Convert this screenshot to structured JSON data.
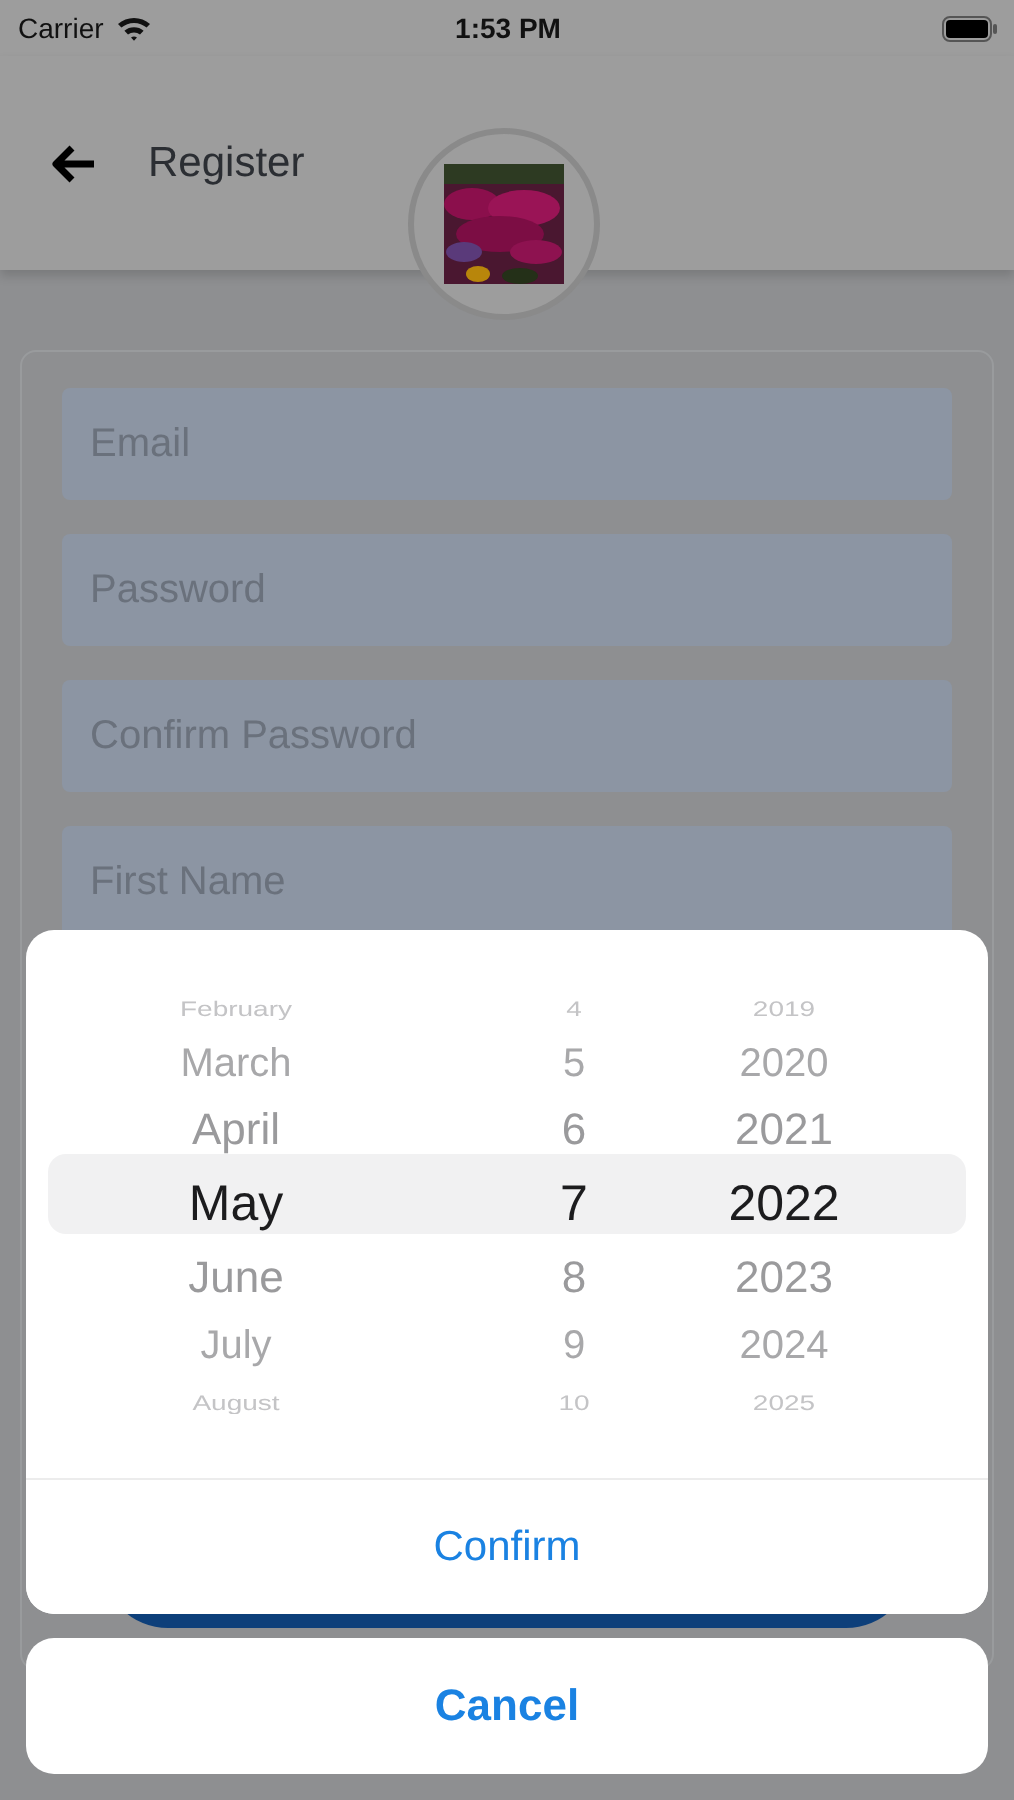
{
  "status_bar": {
    "carrier": "Carrier",
    "time": "1:53 PM"
  },
  "header": {
    "title": "Register"
  },
  "form": {
    "fields": [
      {
        "placeholder": "Email"
      },
      {
        "placeholder": "Password"
      },
      {
        "placeholder": "Confirm Password"
      },
      {
        "placeholder": "First Name"
      }
    ]
  },
  "date_picker": {
    "columns": [
      {
        "kind": "month",
        "items": [
          {
            "label": "February",
            "selected": false
          },
          {
            "label": "March",
            "selected": false
          },
          {
            "label": "April",
            "selected": false
          },
          {
            "label": "May",
            "selected": true
          },
          {
            "label": "June",
            "selected": false
          },
          {
            "label": "July",
            "selected": false
          },
          {
            "label": "August",
            "selected": false
          }
        ]
      },
      {
        "kind": "day",
        "items": [
          {
            "label": "4",
            "selected": false
          },
          {
            "label": "5",
            "selected": false
          },
          {
            "label": "6",
            "selected": false
          },
          {
            "label": "7",
            "selected": true
          },
          {
            "label": "8",
            "selected": false
          },
          {
            "label": "9",
            "selected": false
          },
          {
            "label": "10",
            "selected": false
          }
        ]
      },
      {
        "kind": "year",
        "items": [
          {
            "label": "2019",
            "selected": false
          },
          {
            "label": "2020",
            "selected": false
          },
          {
            "label": "2021",
            "selected": false
          },
          {
            "label": "2022",
            "selected": true
          },
          {
            "label": "2023",
            "selected": false
          },
          {
            "label": "2024",
            "selected": false
          },
          {
            "label": "2025",
            "selected": false
          }
        ]
      }
    ],
    "confirm": "Confirm",
    "cancel": "Cancel"
  }
}
